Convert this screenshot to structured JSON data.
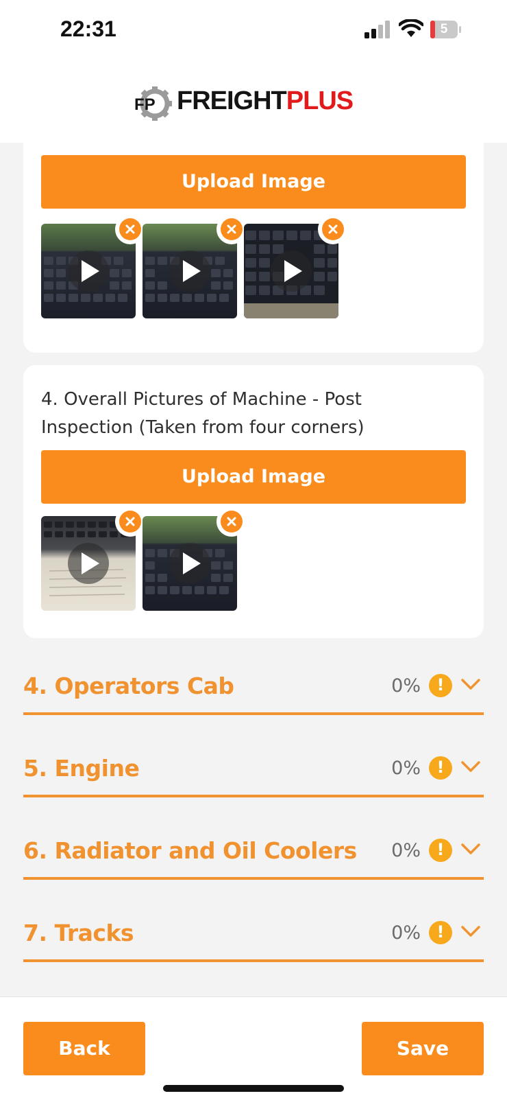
{
  "status_bar": {
    "time": "22:31",
    "battery_level": "5",
    "icons": [
      "signal-icon",
      "wifi-icon",
      "battery-icon"
    ]
  },
  "header": {
    "logo_mark": "FP",
    "brand_part1": "FREIGHT",
    "brand_part2": "PLUS"
  },
  "cards": [
    {
      "upload_label": "Upload Image",
      "media": [
        {
          "kind": "video",
          "icon": "play-icon"
        },
        {
          "kind": "video",
          "icon": "play-icon"
        },
        {
          "kind": "video",
          "icon": "play-icon"
        }
      ]
    },
    {
      "title": "4. Overall Pictures of Machine - Post Inspection (Taken from four corners)",
      "upload_label": "Upload Image",
      "media": [
        {
          "kind": "video",
          "icon": "play-icon"
        },
        {
          "kind": "video",
          "icon": "play-icon"
        }
      ]
    }
  ],
  "sections": [
    {
      "title": "4. Operators Cab",
      "percent": "0%",
      "status_icon": "warning-icon"
    },
    {
      "title": "5. Engine",
      "percent": "0%",
      "status_icon": "warning-icon"
    },
    {
      "title": "6. Radiator and Oil Coolers",
      "percent": "0%",
      "status_icon": "warning-icon"
    },
    {
      "title": "7. Tracks",
      "percent": "0%",
      "status_icon": "warning-icon"
    }
  ],
  "warning_glyph": "!",
  "footer": {
    "back_label": "Back",
    "save_label": "Save"
  },
  "colors": {
    "accent": "#f98c1d",
    "section_title": "#f0922f",
    "warning": "#f7a81b",
    "brand_red": "#e11b1b"
  }
}
